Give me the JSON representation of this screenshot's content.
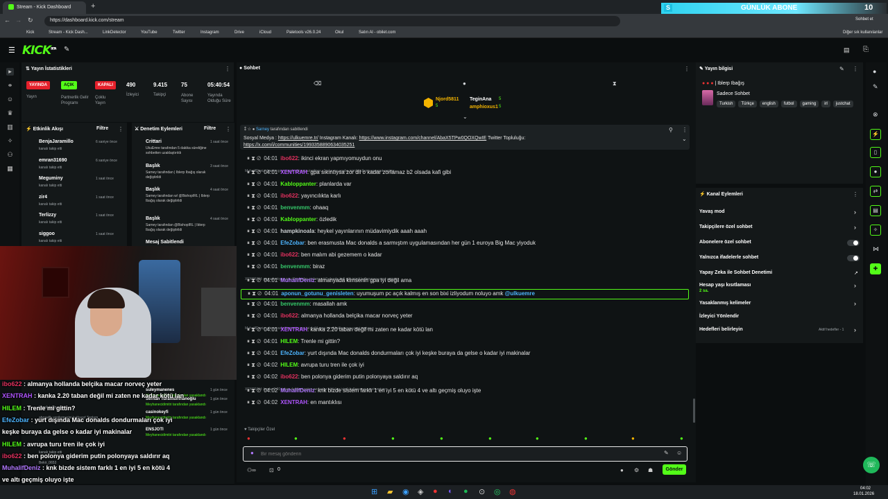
{
  "browser": {
    "tabs": [
      "Stream - Kick Dashboard"
    ],
    "url": "https://dashboard.kick.com/stream",
    "bookmarks": [
      "Kick",
      "Stream - Kick Dash...",
      "LinkDetector",
      "YouTube",
      "Twitter",
      "Instagram",
      "Drive",
      "iCloud",
      "Paletools v26.0.24",
      "Okul",
      "Satın Al - obilet.com"
    ],
    "other_bookmarks": "Diğer sık kullanılanlar",
    "ad_label": "GÜNLÜK ABONE",
    "ad_counter": "10",
    "ad_letter": "S",
    "chat_label": "Sohbet et"
  },
  "kick": {
    "logo": "KICK",
    "beta": "BETA"
  },
  "stats": {
    "title": "Yayın İstatistikleri",
    "badges": [
      {
        "label": "YAYINDA",
        "caption": "Yayın",
        "color": "#e5202b"
      },
      {
        "label": "AÇIK",
        "caption": "Partnerlik Gelir Programı",
        "color": "#53fc18"
      },
      {
        "label": "KAPALI",
        "caption": "Çoklu Yayın",
        "color": "#e5202b"
      }
    ],
    "numbers": [
      {
        "value": "490",
        "caption": "İzleyici"
      },
      {
        "value": "9.415",
        "caption": "Takipçi"
      },
      {
        "value": "75",
        "caption": "Abone Sayısı"
      },
      {
        "value": "05:40:54",
        "caption": "Yayında Olduğu Süre"
      }
    ]
  },
  "activity": {
    "title": "Etkinlik Akışı",
    "filter": "Filtre",
    "items": [
      {
        "name": "BenjaJaramillo",
        "desc": "kanalı takip etti",
        "time": "6 saniye önce"
      },
      {
        "name": "emran31690",
        "desc": "kanalı takip etti",
        "time": "6 saniye önce"
      },
      {
        "name": "Meguminy",
        "desc": "kanalı takip etti",
        "time": "1 saat önce"
      },
      {
        "name": "zir4",
        "desc": "kanalı takip etti",
        "time": "1 saat önce"
      },
      {
        "name": "Terlizzy",
        "desc": "kanalı takip etti",
        "time": "1 saat önce"
      },
      {
        "name": "siggoo",
        "desc": "kanalı takip etti",
        "time": "1 saat önce"
      }
    ]
  },
  "moderation": {
    "title": "Denetim Eylemleri",
    "filter": "Filtre",
    "items": [
      {
        "name": "Crittari",
        "desc": "UkuEmre tarafından 5 dakika süreliğine sohbetten uzaklaştırıldı",
        "time": "1 saat önce"
      },
      {
        "name": "Başlık",
        "desc": "Sarney tarafından | Iblerp Ibağış olarak değiştirildi",
        "time": "3 saat önce"
      },
      {
        "name": "Başlık",
        "desc": "Sarney tarafından w/ @BishopIRL | Iblerp Ibağış olarak değiştirildi",
        "time": "4 saat önce"
      },
      {
        "name": "Başlık",
        "desc": "Sarney tarafından @BishopIRL | Iblerp Ibağış olarak değiştirildi",
        "time": "4 saat önce"
      },
      {
        "name": "Mesaj Sabitlendi",
        "desc": "",
        "time": ""
      }
    ],
    "lower": [
      {
        "name": "suleymanenes",
        "desc": "Meyhanecidimitri tarafından yasaklandı",
        "time": "1 gün önce"
      },
      {
        "name": "Serhan Turantümhanoğlu",
        "desc": "Meyhanecidimitri tarafından yasaklandı",
        "time": "1 gün önce"
      },
      {
        "name": "casinokeyfi",
        "desc": "Meyhanecidimitri tarafından yasaklandı",
        "time": "1 gün önce"
      },
      {
        "name": "ENSJOTI",
        "desc": "Meyhanecidimitri tarafından yasaklandı",
        "time": "1 gün önce"
      }
    ],
    "lower_extra": [
      "kanalı takip etti",
      "abonelik yenilemesini kutluyor! Toplam",
      "kanalı takip etti",
      "Bekir_0653"
    ]
  },
  "chat": {
    "title": "Sohbet",
    "top_users": [
      {
        "name": "Njord5811",
        "count": "5"
      },
      {
        "name": "TeginAna",
        "count": "5"
      },
      {
        "name": "amphioxus1",
        "count": "5"
      }
    ],
    "pinned": {
      "by": "Sarney",
      "suffix": "tarafından sabitlendi",
      "line1a": "Sosyal Medya : ",
      "link1": "https://ulkuemre.tr/",
      "line1b": " Instagram Kanalı: ",
      "link2": "https://www.instagram.com/channel/AbaX5TPw0QOXQwIE",
      "line1c": " Twitter Topluluğu:",
      "link3": "https://x.com/i/communities/1993358890634035251"
    },
    "messages": [
      {
        "time": "04:01",
        "user": "ibo622",
        "color": "#e3315f",
        "text": "ikinci ekran yapmıyomuydun onu"
      },
      {
        "sys": "MuhalifDeniz: benim gpa yarrak gibi ama ingilizce c1 olur mu acaba isimli kullanıcıya yanıt veriyor"
      },
      {
        "time": "04:01",
        "user": "XENTRAH",
        "color": "#b055ff",
        "text": "gpa sıkıntıysa zor dil o kadar zorlamaz b2 olsada kafi gibi"
      },
      {
        "time": "04:01",
        "user": "Kabloppanter",
        "color": "#53fc18",
        "text": "planlarda var"
      },
      {
        "time": "04:01",
        "user": "ibo622",
        "color": "#e3315f",
        "text": "yayıncılıkta karlı"
      },
      {
        "time": "04:01",
        "user": "benvenmm",
        "color": "#36c86a",
        "text": "ohaaq"
      },
      {
        "time": "04:01",
        "user": "Kabloppanter",
        "color": "#53fc18",
        "text": "özledik"
      },
      {
        "time": "04:01",
        "user": "hampkinoala",
        "color": "#cfd2d4",
        "text": "heykel yayınlarının müdavimiydik aaah aaah"
      },
      {
        "time": "04:01",
        "user": "EfeZobar",
        "color": "#4db5ff",
        "text": "ben erasmusta Mac donalds a sarmıştım uygulamasından her gün 1 euroya Big Mac yiyoduk"
      },
      {
        "time": "04:01",
        "user": "ibo622",
        "color": "#e3315f",
        "text": "ben malım abi gezemem o kadar"
      },
      {
        "time": "04:01",
        "user": "benvenmm",
        "color": "#36c86a",
        "text": "biraz"
      },
      {
        "sys": "XENTRAH: gpa sıkıntıysa zor dil o kadar zorlamaz b2 olsada kafi gibi isimli kullanıcıya yanıt veriyor"
      },
      {
        "time": "04:01",
        "user": "MuhalifDeniz",
        "color": "#b279ff",
        "text": "almanyada kimsenin gpa iyi değil ama"
      },
      {
        "time": "04:01",
        "user": "aponun_gotunu_genisleten",
        "color": "#4db5ff",
        "text": "uyumuşum pc açık kalmış en son bixi izliyodum noluyo amk ",
        "mention": "@ulkuemre",
        "hl": true
      },
      {
        "time": "04:01",
        "user": "benvenmm",
        "color": "#36c86a",
        "text": "masallah amk"
      },
      {
        "time": "04:01",
        "user": "ibo622",
        "color": "#e3315f",
        "text": "almanya hollanda belçika macar norveç yeter"
      },
      {
        "sys": "MuhalifDeniz: almanyada kimsenin gpa iyi değil ama isimli kullanıcıya yanıt veriyor"
      },
      {
        "time": "04:01",
        "user": "XENTRAH",
        "color": "#b055ff",
        "text": "kanka 2.20 taban değil mi zaten ne kadar kötü lan"
      },
      {
        "time": "04:01",
        "user": "HILEM",
        "color": "#53fc18",
        "text": "Trenle mi gittin?"
      },
      {
        "time": "04:01",
        "user": "EfeZobar",
        "color": "#4db5ff",
        "text": "yurt dışında Mac donalds dondurmaları çok iyi keşke buraya da gelse o kadar iyi makinalar"
      },
      {
        "time": "04:02",
        "user": "HILEM",
        "color": "#53fc18",
        "text": "avrupa turu tren ile çok iyi"
      },
      {
        "time": "04:02",
        "user": "ibo622",
        "color": "#e3315f",
        "text": "ben polonya giderim putin polonyaya saldırır aq"
      },
      {
        "sys": "XENTRAH: kanka 2.20 taban değil mi zaten ne kadar kötü lan isimli kullanıcıya yanıt veriyor"
      },
      {
        "time": "04:02",
        "user": "MuhalifDeniz",
        "color": "#b279ff",
        "text": "knk bizde sistem farklı 1 en iyi 5 en kötü 4 ve altı geçmiş oluyo işte"
      },
      {
        "time": "04:02",
        "user": "XENTRAH",
        "color": "#b055ff",
        "text": "en mantıklısı"
      }
    ],
    "followers_only": "Takipçiler Özel",
    "placeholder": "Bir mesaj gönderin",
    "send": "Gönder",
    "footer_count": "0"
  },
  "overlay": [
    {
      "user": "ibo622",
      "color": "#e3315f",
      "text": "almanya hollanda belçika macar norveç yeter"
    },
    {
      "user": "XENTRAH",
      "color": "#b055ff",
      "text": "kanka 2.20 taban değil mi zaten ne kadar kötü lan"
    },
    {
      "user": "HILEM",
      "color": "#53fc18",
      "text": "Trenle mi gittin?"
    },
    {
      "user": "EfeZobar",
      "color": "#4db5ff",
      "text": "yurt dışında Mac donalds dondurmaları çok iyi"
    },
    {
      "user": "",
      "color": "#fff",
      "text": "keşke buraya da gelse o kadar iyi makinalar"
    },
    {
      "user": "HILEM",
      "color": "#53fc18",
      "text": "avrupa turu tren ile çok iyi"
    },
    {
      "user": "ibo622",
      "color": "#e3315f",
      "text": "ben polonya giderim putin polonyaya saldırır aq"
    },
    {
      "user": "MuhalifDeniz",
      "color": "#b279ff",
      "text": "knk bizde sistem farklı 1 en iyi 5 en kötü 4"
    },
    {
      "user": "",
      "color": "#fff",
      "text": "ve altı geçmiş oluyo işte"
    },
    {
      "user": "XENTRAH",
      "color": "#b055ff",
      "text": "en mantıklısı"
    }
  ],
  "stream_info": {
    "title": "Yayın bilgisi",
    "stream_title": "| Iblerp Ibağış",
    "category": "Sadece Sohbet",
    "tags": [
      "Turkish",
      "Türkçe",
      "english",
      "futbol",
      "gaming",
      "irl",
      "justchat"
    ]
  },
  "channel_actions": {
    "title": "Kanal Eylemleri",
    "rows": [
      {
        "label": "Yavaş mod",
        "kind": "arrow"
      },
      {
        "label": "Takipçilere özel sohbet",
        "kind": "arrow"
      },
      {
        "label": "Abonelere özel sohbet",
        "kind": "toggle"
      },
      {
        "label": "Yalnızca ifadelerle sohbet",
        "kind": "toggle"
      },
      {
        "label": "Yapay Zeka ile Sohbet Denetimi",
        "kind": "ext"
      },
      {
        "label": "Hesap yaşı kısıtlaması",
        "kind": "arrow",
        "sub": "2 sa."
      },
      {
        "label": "Yasaklanmış kelimeler",
        "kind": "arrow"
      },
      {
        "label": "İzleyici Yönlendir",
        "kind": "none"
      },
      {
        "label": "Hedefleri belirleyin",
        "kind": "goal",
        "note": "Aktif hedefler - 1"
      }
    ]
  },
  "taskbar": {
    "time": "04:02",
    "date": "18.01.2026"
  }
}
